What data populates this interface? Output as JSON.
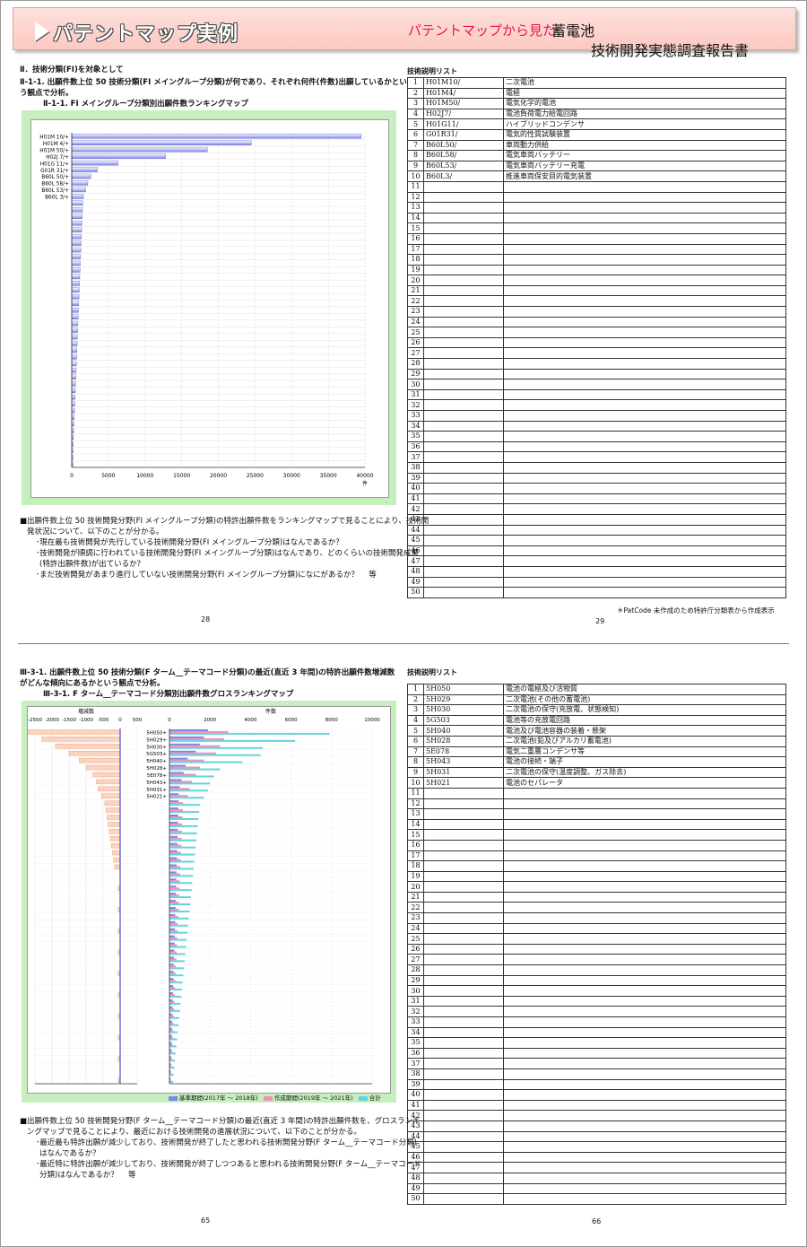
{
  "header": {
    "title": "パテントマップ実例",
    "subtitle": "パテントマップから見た",
    "subject": "蓄電池",
    "report": "技術開発実態調査報告書"
  },
  "section1": {
    "heading": "Ⅱ．技術分類(FI)を対象として",
    "lead1": "Ⅱ-1-1. 出願件数上位 50 技術分類(FI メイングループ分類)が何であり、それぞれ何件(件数)出願しているかとい",
    "lead2": "う観点で分析。",
    "chart_title": "Ⅱ-1-1. FI メイングループ分類別出願件数ランキングマップ",
    "body1": "■出願件数上位 50 技術開発分野(FI メイングループ分類)の特許出願件数をランキングマップで見ることにより、技術開",
    "body2": "発状況について、以下のことが分かる。",
    "b1": "･現在最も技術開発が先行している技術開発分野(FI メイングループ分類)はなんであるか？",
    "b2": "･技術開発が順調に行われている技術開発分野(FI メイングループ分類)はなんであり、どのくらいの技術開発成果",
    "b3": "(特許出願件数)が出ているか？",
    "b4": "･まだ技術開発があまり進行していない技術開発分野(FI メイングループ分類)になにがあるか？　 等",
    "page_left": "28",
    "page_right": "29",
    "list_title": "技術説明リスト",
    "note": "＊PatCode 未作成のため特許庁分類表から作成表示",
    "rows": [
      {
        "no": "1",
        "code": "H01M10/",
        "desc": "二次電池"
      },
      {
        "no": "2",
        "code": "H01M4/",
        "desc": "電極"
      },
      {
        "no": "3",
        "code": "H01M50/",
        "desc": "電気化学的電池"
      },
      {
        "no": "4",
        "code": "H02J7/",
        "desc": "電池負荷電力給電回路"
      },
      {
        "no": "5",
        "code": "H01G11/",
        "desc": "ハイブリッドコンデンサ"
      },
      {
        "no": "6",
        "code": "G01R31/",
        "desc": "電気的性質試験装置"
      },
      {
        "no": "7",
        "code": "B60L50/",
        "desc": "車両動力供給"
      },
      {
        "no": "8",
        "code": "B60L58/",
        "desc": "電気車両バッテリー"
      },
      {
        "no": "9",
        "code": "B60L53/",
        "desc": "電気車両バッテリー充電"
      },
      {
        "no": "10",
        "code": "B60L3/",
        "desc": "推進車両保安目的電気装置"
      },
      {
        "no": "11",
        "code": "",
        "desc": ""
      },
      {
        "no": "12",
        "code": "",
        "desc": ""
      },
      {
        "no": "13",
        "code": "",
        "desc": ""
      },
      {
        "no": "14",
        "code": "",
        "desc": ""
      },
      {
        "no": "15",
        "code": "",
        "desc": ""
      },
      {
        "no": "16",
        "code": "",
        "desc": ""
      },
      {
        "no": "17",
        "code": "",
        "desc": ""
      },
      {
        "no": "18",
        "code": "",
        "desc": ""
      },
      {
        "no": "19",
        "code": "",
        "desc": ""
      },
      {
        "no": "20",
        "code": "",
        "desc": ""
      },
      {
        "no": "21",
        "code": "",
        "desc": ""
      },
      {
        "no": "22",
        "code": "",
        "desc": ""
      },
      {
        "no": "23",
        "code": "",
        "desc": ""
      },
      {
        "no": "24",
        "code": "",
        "desc": ""
      },
      {
        "no": "25",
        "code": "",
        "desc": ""
      },
      {
        "no": "26",
        "code": "",
        "desc": ""
      },
      {
        "no": "27",
        "code": "",
        "desc": ""
      },
      {
        "no": "28",
        "code": "",
        "desc": ""
      },
      {
        "no": "29",
        "code": "",
        "desc": ""
      },
      {
        "no": "30",
        "code": "",
        "desc": ""
      },
      {
        "no": "31",
        "code": "",
        "desc": ""
      },
      {
        "no": "32",
        "code": "",
        "desc": ""
      },
      {
        "no": "33",
        "code": "",
        "desc": ""
      },
      {
        "no": "34",
        "code": "",
        "desc": ""
      },
      {
        "no": "35",
        "code": "",
        "desc": ""
      },
      {
        "no": "36",
        "code": "",
        "desc": ""
      },
      {
        "no": "37",
        "code": "",
        "desc": ""
      },
      {
        "no": "38",
        "code": "",
        "desc": ""
      },
      {
        "no": "39",
        "code": "",
        "desc": ""
      },
      {
        "no": "40",
        "code": "",
        "desc": ""
      },
      {
        "no": "41",
        "code": "",
        "desc": ""
      },
      {
        "no": "42",
        "code": "",
        "desc": ""
      },
      {
        "no": "43",
        "code": "",
        "desc": ""
      },
      {
        "no": "44",
        "code": "",
        "desc": ""
      },
      {
        "no": "45",
        "code": "",
        "desc": ""
      },
      {
        "no": "46",
        "code": "",
        "desc": ""
      },
      {
        "no": "47",
        "code": "",
        "desc": ""
      },
      {
        "no": "48",
        "code": "",
        "desc": ""
      },
      {
        "no": "49",
        "code": "",
        "desc": ""
      },
      {
        "no": "50",
        "code": "",
        "desc": ""
      }
    ]
  },
  "section2": {
    "lead1": "Ⅲ-3-1. 出願件数上位 50 技術分類(F ターム__テーマコード分類)の最近(直近 3 年間)の特許出願件数増減数",
    "lead2": "がどんな傾向にあるかという観点で分析。",
    "chart_title": "Ⅲ-3-1. F ターム__テーマコード分類別出願件数グロスランキングマップ",
    "body1": "■出願件数上位 50 技術開発分野(F ターム__テーマコード分類)の最近(直近 3 年間)の特許出願件数を、グロスランキ",
    "body2": "ングマップで見ることにより、最近における技術開発の進展状況について、以下のことが分かる。",
    "b1": "･最近最も特許出願が減少しており、技術開発が終了したと思われる技術開発分野(F ターム__テーマコード分類)",
    "b2": "はなんであるか？",
    "b3": "･最近特に特許出願が減少しており、技術開発が終了しつつあると思われる技術開発分野(F ターム__テーマコード",
    "b4": "分類)はなんであるか？　 等",
    "page_left": "65",
    "page_right": "66",
    "list_title": "技術説明リスト",
    "legend": {
      "l1": "基準期間(2017年 ～ 2018年)",
      "l2": "作成期間(2019年 ～ 2021年)",
      "l3": "合計"
    },
    "rows": [
      {
        "no": "1",
        "code": "5H050",
        "desc": "電池の電極及び活物質"
      },
      {
        "no": "2",
        "code": "5H029",
        "desc": "二次電池(その他の蓄電池)"
      },
      {
        "no": "3",
        "code": "5H030",
        "desc": "二次電池の保守(充放電、状態検知)"
      },
      {
        "no": "4",
        "code": "5G503",
        "desc": "電池等の充放電回路"
      },
      {
        "no": "5",
        "code": "5H040",
        "desc": "電池及び電池容器の装着・懸架"
      },
      {
        "no": "6",
        "code": "5H028",
        "desc": "二次電池(鉛及びアルカリ蓄電池)"
      },
      {
        "no": "7",
        "code": "5E078",
        "desc": "電気二重層コンデンサ等"
      },
      {
        "no": "8",
        "code": "5H043",
        "desc": "電池の接続・端子"
      },
      {
        "no": "9",
        "code": "5H031",
        "desc": "二次電池の保守(温度調整、ガス除去)"
      },
      {
        "no": "10",
        "code": "5H021",
        "desc": "電池のセパレータ"
      },
      {
        "no": "11",
        "code": "",
        "desc": ""
      },
      {
        "no": "12",
        "code": "",
        "desc": ""
      },
      {
        "no": "13",
        "code": "",
        "desc": ""
      },
      {
        "no": "14",
        "code": "",
        "desc": ""
      },
      {
        "no": "15",
        "code": "",
        "desc": ""
      },
      {
        "no": "16",
        "code": "",
        "desc": ""
      },
      {
        "no": "17",
        "code": "",
        "desc": ""
      },
      {
        "no": "18",
        "code": "",
        "desc": ""
      },
      {
        "no": "19",
        "code": "",
        "desc": ""
      },
      {
        "no": "20",
        "code": "",
        "desc": ""
      },
      {
        "no": "21",
        "code": "",
        "desc": ""
      },
      {
        "no": "22",
        "code": "",
        "desc": ""
      },
      {
        "no": "23",
        "code": "",
        "desc": ""
      },
      {
        "no": "24",
        "code": "",
        "desc": ""
      },
      {
        "no": "25",
        "code": "",
        "desc": ""
      },
      {
        "no": "26",
        "code": "",
        "desc": ""
      },
      {
        "no": "27",
        "code": "",
        "desc": ""
      },
      {
        "no": "28",
        "code": "",
        "desc": ""
      },
      {
        "no": "29",
        "code": "",
        "desc": ""
      },
      {
        "no": "30",
        "code": "",
        "desc": ""
      },
      {
        "no": "31",
        "code": "",
        "desc": ""
      },
      {
        "no": "32",
        "code": "",
        "desc": ""
      },
      {
        "no": "33",
        "code": "",
        "desc": ""
      },
      {
        "no": "34",
        "code": "",
        "desc": ""
      },
      {
        "no": "35",
        "code": "",
        "desc": ""
      },
      {
        "no": "36",
        "code": "",
        "desc": ""
      },
      {
        "no": "37",
        "code": "",
        "desc": ""
      },
      {
        "no": "38",
        "code": "",
        "desc": ""
      },
      {
        "no": "39",
        "code": "",
        "desc": ""
      },
      {
        "no": "40",
        "code": "",
        "desc": ""
      },
      {
        "no": "41",
        "code": "",
        "desc": ""
      },
      {
        "no": "42",
        "code": "",
        "desc": ""
      },
      {
        "no": "43",
        "code": "",
        "desc": ""
      },
      {
        "no": "44",
        "code": "",
        "desc": ""
      },
      {
        "no": "45",
        "code": "",
        "desc": ""
      },
      {
        "no": "46",
        "code": "",
        "desc": ""
      },
      {
        "no": "47",
        "code": "",
        "desc": ""
      },
      {
        "no": "48",
        "code": "",
        "desc": ""
      },
      {
        "no": "49",
        "code": "",
        "desc": ""
      },
      {
        "no": "50",
        "code": "",
        "desc": ""
      }
    ]
  },
  "colors": {
    "accent": "#e8174a",
    "panel": "#c7eebe",
    "bar_blue": "#7f85e6",
    "bar_pink": "#f08fb4",
    "bar_cyan": "#63d3e0",
    "bar_orange": "#f4a37a"
  },
  "chart_data": [
    {
      "type": "bar",
      "orientation": "horizontal",
      "categories": [
        "H01M 10/+",
        "H01M 4/+",
        "H01M 50/+",
        "H02J 7/+",
        "H01G 11/+",
        "G01R 31/+",
        "B60L 50/+",
        "B60L 58/+",
        "B60L 53/+",
        "B60L 3/+"
      ],
      "values": [
        39500,
        24500,
        18500,
        12800,
        6300,
        3500,
        2600,
        2200,
        1900,
        1600
      ],
      "tail_count": 40,
      "xticks": [
        "0",
        "5000",
        "10000",
        "15000",
        "20000",
        "25000",
        "30000",
        "35000",
        "40000"
      ],
      "xunit": "件",
      "xlim": [
        0,
        40000
      ]
    },
    {
      "type": "bar",
      "orientation": "horizontal",
      "categories": [
        "5H050+",
        "5H029+",
        "5H030+",
        "5G503+",
        "5H040+",
        "5H028+",
        "5E078+",
        "5H043+",
        "5H031+",
        "5H021+"
      ],
      "series": [
        {
          "name": "基準期間(2017年 ～ 2018年)",
          "values": [
            1900,
            1700,
            1500,
            1300,
            900,
            800,
            700,
            600,
            500,
            450
          ]
        },
        {
          "name": "作成期間(2019年 ～ 2021年)",
          "values": [
            2900,
            2700,
            2500,
            2300,
            1700,
            1500,
            1300,
            1100,
            1000,
            900
          ]
        },
        {
          "name": "合計",
          "values": [
            7900,
            6200,
            4600,
            4500,
            3600,
            2500,
            2200,
            2000,
            1900,
            1700
          ]
        }
      ],
      "change": [
        -2800,
        -2300,
        -1900,
        -1500,
        -1200,
        -1000,
        -800,
        -700,
        -650,
        -550
      ],
      "change_label": "増減数",
      "change_ticks": [
        "-2500",
        "-2000",
        "-1500",
        "-1000",
        "-500",
        "0",
        "500"
      ],
      "change_xlim": [
        -2500,
        500
      ],
      "total_label": "件数",
      "total_ticks": [
        "0",
        "2000",
        "4000",
        "6000",
        "8000",
        "10000"
      ],
      "xlim": [
        0,
        10000
      ],
      "tail_count": 40
    }
  ]
}
